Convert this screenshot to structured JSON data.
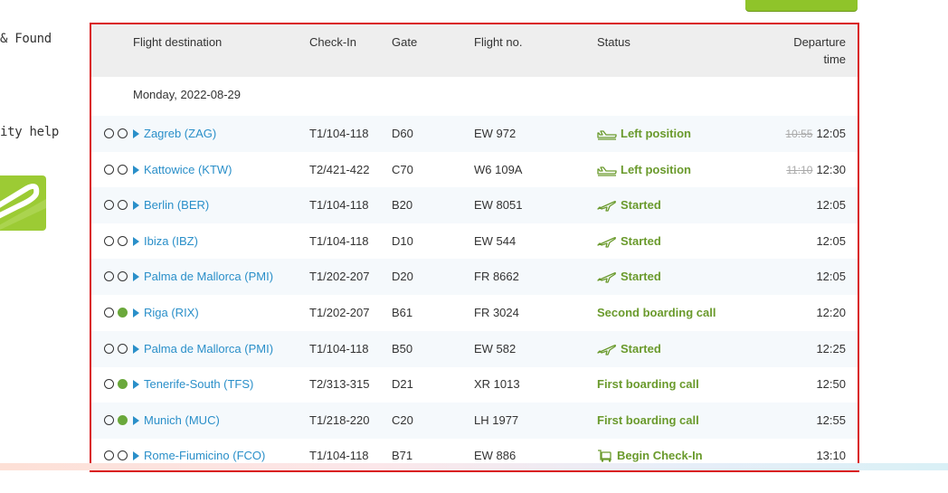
{
  "left_nav": {
    "lost_found": "& Found",
    "security_help": "ity help"
  },
  "table": {
    "headers": {
      "destination": "Flight destination",
      "checkin": "Check-In",
      "gate": "Gate",
      "flightno": "Flight no.",
      "status": "Status",
      "departure_line1": "Departure",
      "departure_line2": "time"
    },
    "date": "Monday, 2022-08-29",
    "rows": [
      {
        "dest": "Zagreb (ZAG)",
        "checkin": "T1/104-118",
        "gate": "D60",
        "flight": "EW 972",
        "status": "Left position",
        "status_icon": "plane-taxi-icon",
        "old_time": "10:55",
        "time": "12:05",
        "c1": false,
        "c2": false
      },
      {
        "dest": "Kattowice (KTW)",
        "checkin": "T2/421-422",
        "gate": "C70",
        "flight": "W6 109A",
        "status": "Left position",
        "status_icon": "plane-taxi-icon",
        "old_time": "11:10",
        "time": "12:30",
        "c1": false,
        "c2": false
      },
      {
        "dest": "Berlin (BER)",
        "checkin": "T1/104-118",
        "gate": "B20",
        "flight": "EW 8051",
        "status": "Started",
        "status_icon": "plane-takeoff-icon",
        "old_time": "",
        "time": "12:05",
        "c1": false,
        "c2": false
      },
      {
        "dest": "Ibiza (IBZ)",
        "checkin": "T1/104-118",
        "gate": "D10",
        "flight": "EW 544",
        "status": "Started",
        "status_icon": "plane-takeoff-icon",
        "old_time": "",
        "time": "12:05",
        "c1": false,
        "c2": false
      },
      {
        "dest": "Palma de Mallorca (PMI)",
        "checkin": "T1/202-207",
        "gate": "D20",
        "flight": "FR 8662",
        "status": "Started",
        "status_icon": "plane-takeoff-icon",
        "old_time": "",
        "time": "12:05",
        "c1": false,
        "c2": false
      },
      {
        "dest": "Riga (RIX)",
        "checkin": "T1/202-207",
        "gate": "B61",
        "flight": "FR 3024",
        "status": "Second boarding call",
        "status_icon": "",
        "old_time": "",
        "time": "12:20",
        "c1": false,
        "c2": true
      },
      {
        "dest": "Palma de Mallorca (PMI)",
        "checkin": "T1/104-118",
        "gate": "B50",
        "flight": "EW 582",
        "status": "Started",
        "status_icon": "plane-takeoff-icon",
        "old_time": "",
        "time": "12:25",
        "c1": false,
        "c2": false
      },
      {
        "dest": "Tenerife-South (TFS)",
        "checkin": "T2/313-315",
        "gate": "D21",
        "flight": "XR 1013",
        "status": "First boarding call",
        "status_icon": "",
        "old_time": "",
        "time": "12:50",
        "c1": false,
        "c2": true
      },
      {
        "dest": "Munich (MUC)",
        "checkin": "T1/218-220",
        "gate": "C20",
        "flight": "LH 1977",
        "status": "First boarding call",
        "status_icon": "",
        "old_time": "",
        "time": "12:55",
        "c1": false,
        "c2": true
      },
      {
        "dest": "Rome-Fiumicino (FCO)",
        "checkin": "T1/104-118",
        "gate": "B71",
        "flight": "EW 886",
        "status": "Begin Check-In",
        "status_icon": "luggage-cart-icon",
        "old_time": "",
        "time": "13:10",
        "c1": false,
        "c2": false
      }
    ]
  },
  "colors": {
    "border": "#d9191c",
    "link": "#2a8fc9",
    "status": "#6a9a2c",
    "accent": "#8fc42a"
  }
}
